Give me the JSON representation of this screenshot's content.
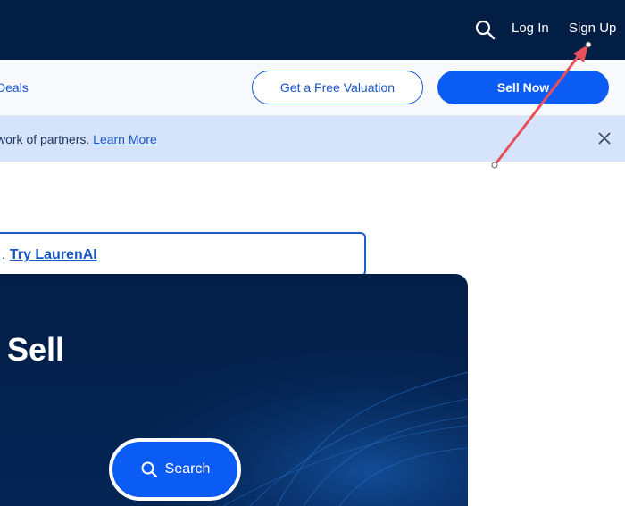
{
  "header": {
    "login_label": "Log In",
    "signup_label": "Sign Up",
    "search_icon": "search-icon"
  },
  "subnav": {
    "deals_label": "Deals",
    "valuation_label": "Get a Free Valuation",
    "sell_label": "Sell Now"
  },
  "banner": {
    "text": "work of partners.",
    "link_label": "Learn More",
    "close_icon": "close-icon"
  },
  "ai_search": {
    "prefix": ".",
    "link_label": "Try LaurenAI"
  },
  "hero": {
    "title": "Sell",
    "search_button_label": "Search",
    "search_icon": "search-icon"
  },
  "annotation": {
    "type": "arrow",
    "color": "#e8505b"
  },
  "colors": {
    "navy": "#031e45",
    "accent_blue": "#0b5cf5",
    "link_blue": "#1757c7",
    "banner_bg": "#d6e4fb"
  }
}
